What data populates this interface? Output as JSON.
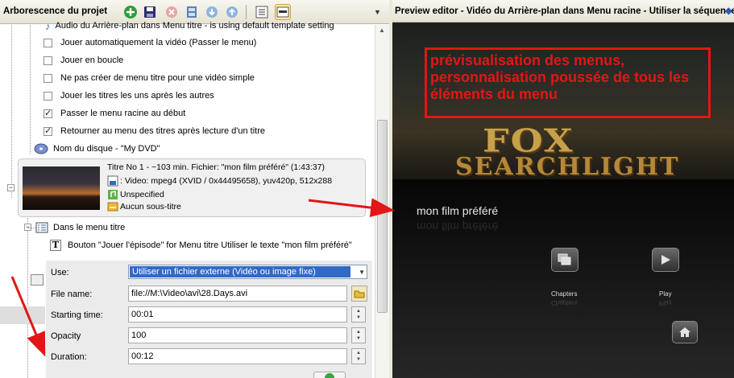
{
  "left_panel": {
    "title": "Arborescence du projet",
    "tree": {
      "audio_item": "Audio du Arrière-plan dans Menu titre - is using default template setting",
      "options": [
        {
          "label": "Jouer automatiquement la vidéo (Passer le menu)",
          "checked": false
        },
        {
          "label": "Jouer en boucle",
          "checked": false
        },
        {
          "label": "Ne pas créer de menu titre pour une vidéo simple",
          "checked": false
        },
        {
          "label": "Jouer les titres les uns après les autres",
          "checked": false
        },
        {
          "label": "Passer le menu racine au début",
          "checked": true
        },
        {
          "label": "Retourner au menu des titres après lecture d'un titre",
          "checked": true
        }
      ],
      "disc_name": "Nom du disque - \"My DVD\"",
      "title_card": {
        "line1": "Titre No 1 - ~103 min. Fichier: \"mon film préféré\" (1:43:37)",
        "line2": ": Video: mpeg4 (XVID / 0x44495658), yuv420p, 512x288",
        "line3": "Unspecified",
        "line4": "Aucun sous-titre"
      },
      "menu_node": "Dans le menu titre",
      "button_item": "Bouton \"Jouer l'épisode\" for Menu titre Utiliser le texte \"mon film préféré\""
    },
    "form": {
      "use_label": "Use:",
      "use_value": "Utiliser un fichier externe (Vidéo ou image fixe)",
      "filename_label": "File name:",
      "filename_value": "file://M:\\Video\\avi\\28.Days.avi",
      "starting_label": "Starting time:",
      "starting_value": "00:01",
      "opacity_label": "Opacity",
      "opacity_value": "100",
      "duration_label": "Duration:",
      "duration_value": "00:12"
    }
  },
  "right_panel": {
    "title": "Preview editor - Vidéo du Arrière-plan dans Menu racine - Utiliser la séquence",
    "annotation": "prévisualisation des menus, personnalisation poussée de tous les éléments du menu",
    "logo_top": "FOX",
    "logo_bottom": "SEARCHLIGHT",
    "film_title": "mon film préféré",
    "buttons": [
      {
        "label": "Chapters",
        "icon": "chapters-icon"
      },
      {
        "label": "Play",
        "icon": "play-icon"
      }
    ],
    "home_icon": "home-icon"
  },
  "colors": {
    "annotation_red": "#e21616",
    "selection_blue": "#316ac5"
  }
}
